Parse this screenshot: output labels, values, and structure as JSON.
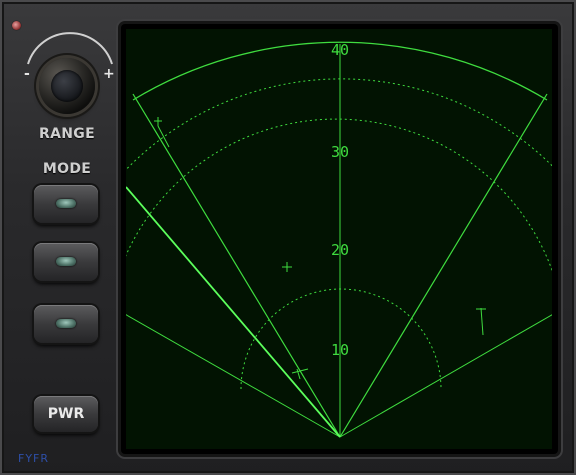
{
  "controls": {
    "range_label": "RANGE",
    "knob_minus": "-",
    "knob_plus": "+",
    "mode_label": "MODE",
    "power_label": "PWR"
  },
  "brand": "FYFR",
  "radar": {
    "range_labels": [
      "10",
      "20",
      "30",
      "40"
    ],
    "colors": {
      "trace": "#3fdc3f",
      "background": "#021302"
    }
  }
}
